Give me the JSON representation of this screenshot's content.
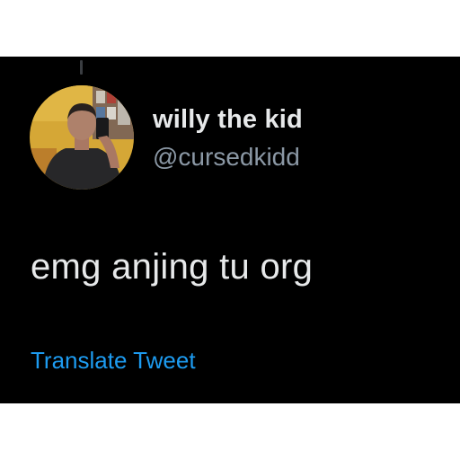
{
  "tweet": {
    "user_name": "willy the kid",
    "user_handle": "@cursedkidd",
    "text": "emg anjing tu org",
    "translate_label": "Translate Tweet"
  },
  "colors": {
    "background": "#000000",
    "name_text": "#e7e9ea",
    "handle_text": "#8b98a5",
    "link_blue": "#1d9bf0"
  },
  "icons": {
    "avatar": "profile-photo"
  }
}
